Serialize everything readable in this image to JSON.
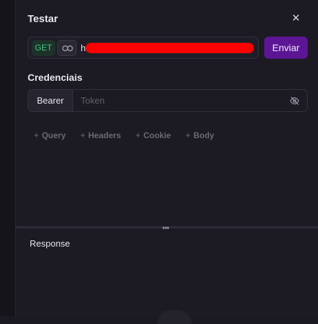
{
  "modal": {
    "title": "Testar",
    "close_icon": "close-icon"
  },
  "request": {
    "method": "GET",
    "method_color": "#3ecb86",
    "url_visible_prefix": "h",
    "send_label": "Enviar",
    "send_color": "#5c1594"
  },
  "credentials": {
    "label": "Credenciais",
    "scheme": "Bearer",
    "token_placeholder": "Token",
    "token_value": ""
  },
  "tabs": [
    {
      "label": "Query"
    },
    {
      "label": "Headers"
    },
    {
      "label": "Cookie"
    },
    {
      "label": "Body"
    }
  ],
  "response": {
    "label": "Response"
  }
}
